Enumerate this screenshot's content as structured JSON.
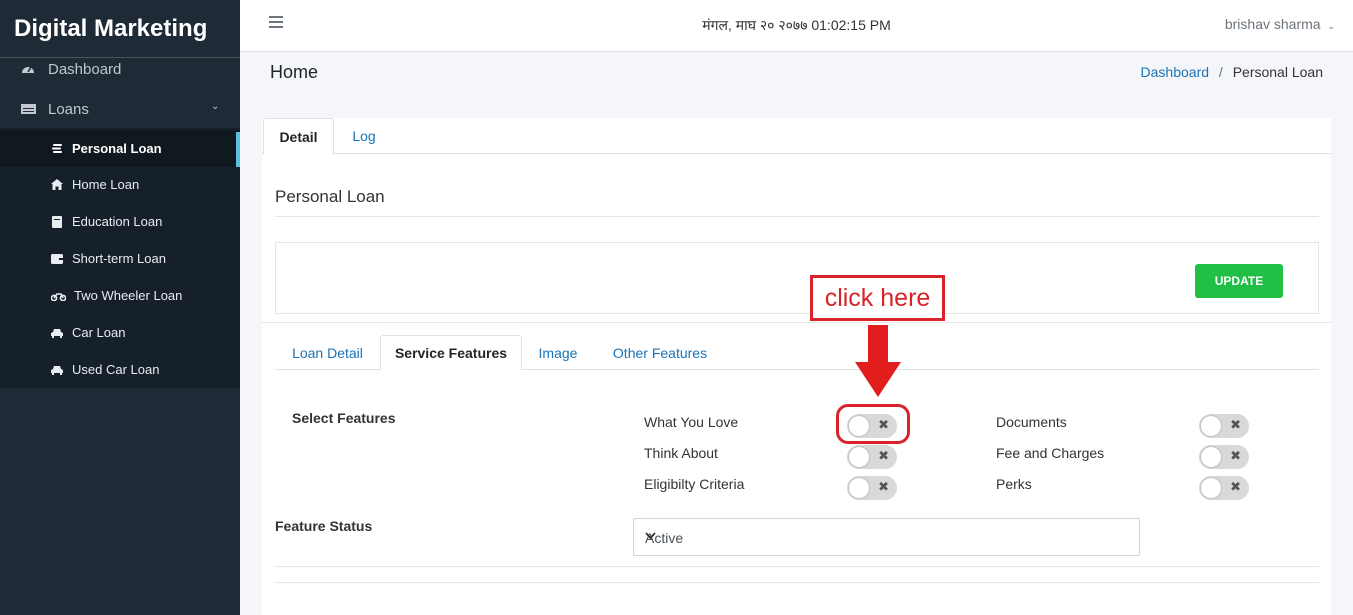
{
  "sidebar": {
    "brand": "Digital Marketing",
    "dashboard": "Dashboard",
    "loans": "Loans",
    "items": [
      {
        "label": "Personal Loan",
        "icon": "coins-icon",
        "active": true
      },
      {
        "label": "Home Loan",
        "icon": "home-icon"
      },
      {
        "label": "Education Loan",
        "icon": "book-icon"
      },
      {
        "label": "Short-term Loan",
        "icon": "wallet-icon"
      },
      {
        "label": "Two Wheeler Loan",
        "icon": "motorcycle-icon"
      },
      {
        "label": "Car Loan",
        "icon": "car-icon"
      },
      {
        "label": "Used Car Loan",
        "icon": "car-icon"
      }
    ]
  },
  "topbar": {
    "datetime": "मंगल, माघ २० २०७७ 01:02:15 PM",
    "user": "brishav sharma"
  },
  "header": {
    "title": "Home",
    "breadcrumb_home": "Dashboard",
    "breadcrumb_separator": "/",
    "breadcrumb_current": "Personal Loan"
  },
  "card": {
    "tabs": [
      "Detail",
      "Log"
    ],
    "section_title": "Personal Loan",
    "update_label": "UPDATE",
    "inner_tabs": [
      "Loan Detail",
      "Service Features",
      "Image",
      "Other Features"
    ],
    "select_features_label": "Select Features",
    "features_left": [
      "What You Love",
      "Think About",
      "Eligibilty Criteria"
    ],
    "features_right": [
      "Documents",
      "Fee and Charges",
      "Perks"
    ],
    "feature_status_label": "Feature Status",
    "feature_status_value": "Active"
  },
  "annotation": {
    "callout": "click here",
    "color": "#d8232a"
  },
  "colors": {
    "sidebar_bg": "#1e2a36",
    "link": "#1a73b7",
    "update_green": "#20c047"
  }
}
